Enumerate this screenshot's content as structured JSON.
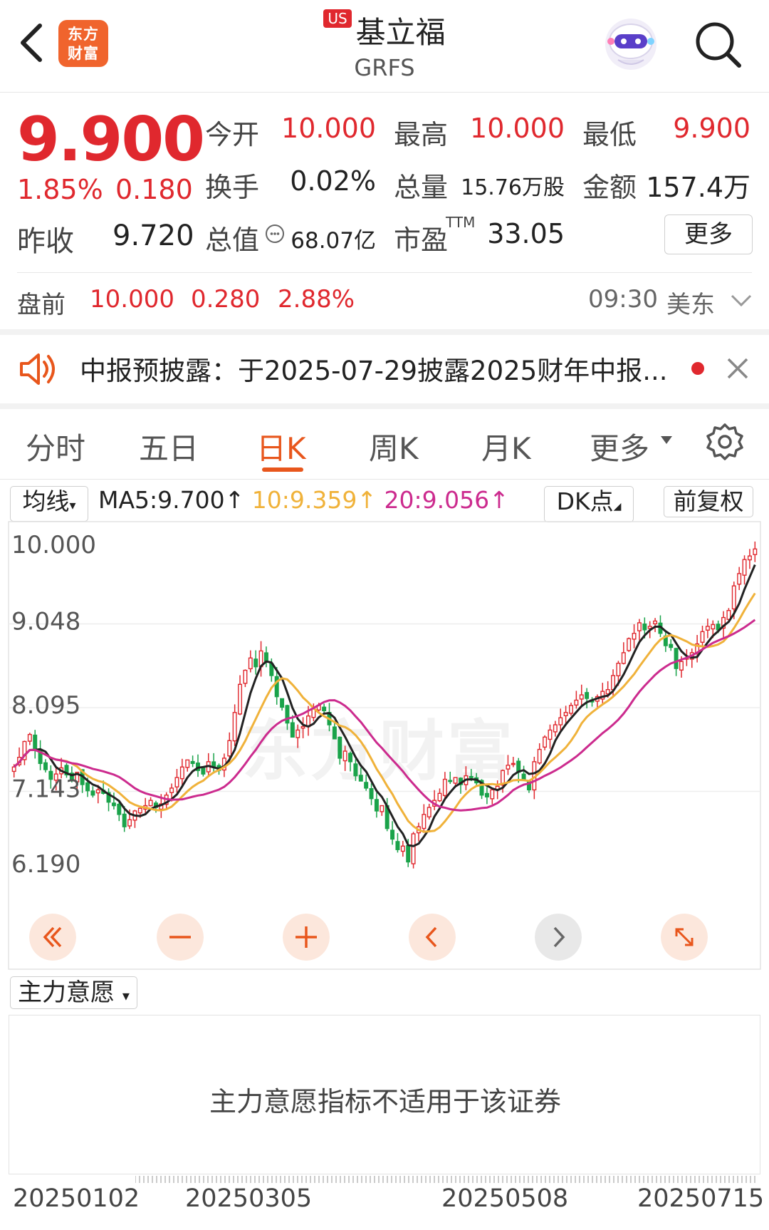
{
  "header": {
    "logo_text_line1": "东方",
    "logo_text_line2": "财富",
    "market_badge": "US",
    "stock_name": "基立福",
    "stock_code": "GRFS"
  },
  "quote": {
    "price": "9.900",
    "change_pct": "1.85%",
    "change": "0.180",
    "prev_close_label": "昨收",
    "prev_close": "9.720",
    "open_label": "今开",
    "open": "10.000",
    "high_label": "最高",
    "high": "10.000",
    "low_label": "最低",
    "low": "9.900",
    "turnover_label": "换手",
    "turnover": "0.02%",
    "volume_label": "总量",
    "volume": "15.76万股",
    "amount_label": "金额",
    "amount": "157.4万",
    "market_cap_label": "总值",
    "market_cap": "68.07亿",
    "pe_label": "市盈",
    "pe_sup": "TTM",
    "pe": "33.05",
    "more_button": "更多"
  },
  "premarket": {
    "label": "盘前",
    "price": "10.000",
    "change": "0.280",
    "change_pct": "2.88%",
    "time": "09:30",
    "timezone": "美东"
  },
  "notice": {
    "text": "中报预披露：于2025-07-29披露2025财年中报..."
  },
  "tabs": [
    "分时",
    "五日",
    "日K",
    "周K",
    "月K",
    "更多"
  ],
  "active_tab": "日K",
  "chart_toolbar": {
    "ma_type": "均线",
    "ma5": "MA5:9.700",
    "ma10": "10:9.359",
    "ma20": "20:9.056",
    "dk_button": "DK点",
    "adjust_button": "前复权"
  },
  "chart_data": {
    "type": "candlestick",
    "y_ticks": [
      "10.000",
      "9.048",
      "8.095",
      "7.143",
      "6.190"
    ],
    "ylim": [
      6.19,
      10.0
    ],
    "x_ticks": [
      "20250102",
      "20250305",
      "20250508",
      "20250715"
    ],
    "watermark": "东方财富",
    "colors": {
      "up": "#e0282e",
      "down": "#1aa34a",
      "ma5": "#222222",
      "ma10": "#f0b23a",
      "ma20": "#cc2b8e"
    },
    "closes": [
      7.42,
      7.53,
      7.71,
      7.79,
      7.62,
      7.46,
      7.39,
      7.28,
      7.34,
      7.41,
      7.33,
      7.27,
      7.36,
      7.22,
      7.15,
      7.1,
      7.16,
      7.12,
      7.02,
      6.98,
      6.88,
      6.74,
      6.82,
      6.92,
      6.95,
      6.98,
      7.04,
      6.96,
      7.0,
      7.1,
      7.18,
      7.3,
      7.42,
      7.5,
      7.46,
      7.38,
      7.34,
      7.48,
      7.42,
      7.38,
      7.52,
      7.72,
      8.04,
      8.36,
      8.52,
      8.66,
      8.56,
      8.74,
      8.62,
      8.46,
      8.22,
      8.1,
      7.92,
      7.76,
      7.84,
      7.88,
      8.0,
      8.08,
      8.12,
      8.06,
      7.9,
      7.74,
      7.52,
      7.6,
      7.48,
      7.32,
      7.26,
      7.18,
      7.06,
      6.92,
      6.98,
      6.72,
      6.6,
      6.48,
      6.52,
      6.34,
      6.66,
      6.74,
      6.88,
      6.96,
      7.04,
      7.12,
      7.28,
      7.26,
      7.3,
      7.22,
      7.32,
      7.3,
      7.24,
      7.1,
      7.08,
      7.16,
      7.2,
      7.38,
      7.44,
      7.46,
      7.36,
      7.28,
      7.16,
      7.48,
      7.62,
      7.76,
      7.84,
      7.9,
      7.98,
      8.04,
      8.12,
      8.18,
      8.24,
      8.2,
      8.16,
      8.22,
      8.28,
      8.3,
      8.46,
      8.6,
      8.72,
      8.88,
      8.94,
      9.06,
      8.98,
      9.02,
      9.08,
      8.94,
      8.8,
      8.78,
      8.54,
      8.62,
      8.66,
      8.72,
      8.82,
      8.96,
      9.02,
      9.04,
      8.98,
      9.12,
      9.2,
      9.48,
      9.62,
      9.78,
      9.82,
      9.9
    ]
  },
  "indicator": {
    "dropdown_label": "主力意愿",
    "message": "主力意愿指标不适用于该证券"
  }
}
